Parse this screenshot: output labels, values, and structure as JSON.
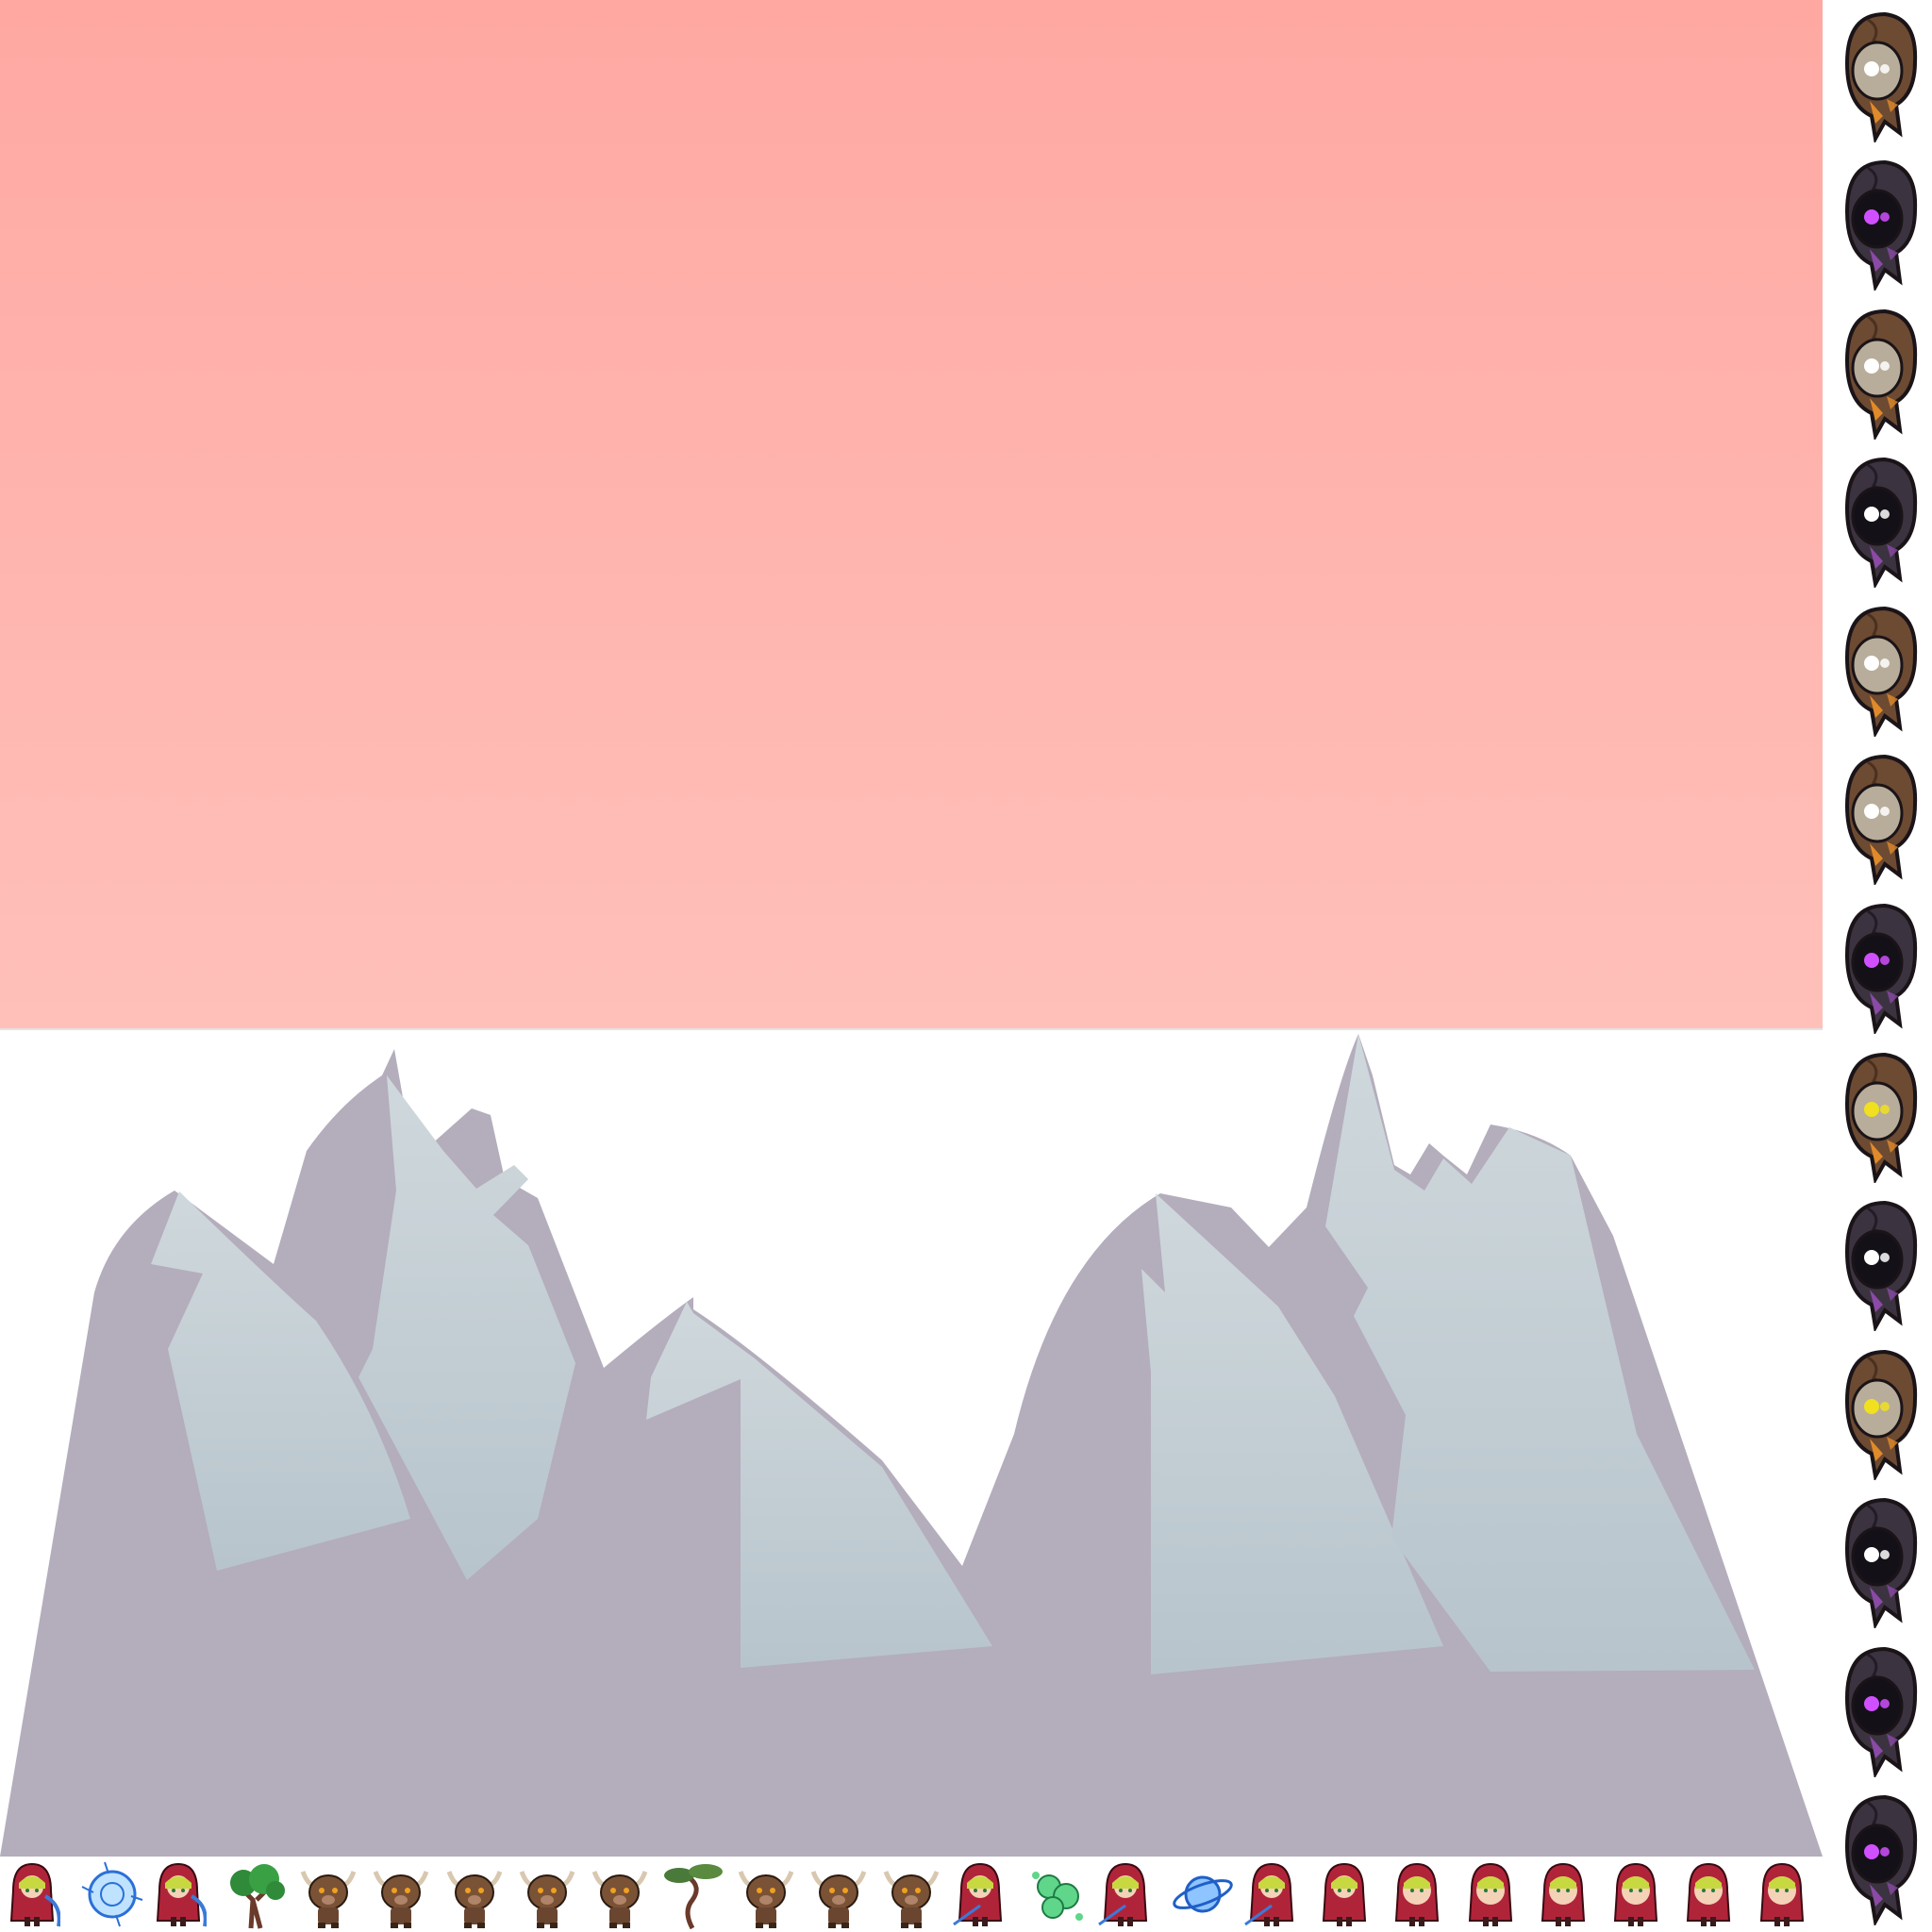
{
  "scene": {
    "sky": {
      "color_top": "#ffa8a2",
      "color_bottom": "#ffc0ba"
    },
    "mountains": {
      "shadow_color": "#b4adbc",
      "snow_top": "#cfd8dc",
      "snow_bottom": "#b7c4cc"
    }
  },
  "ghost_column": [
    {
      "kind": "brown-ghost",
      "eye": "#ffffff"
    },
    {
      "kind": "dark-ghost",
      "eye": "#d050ff"
    },
    {
      "kind": "brown-ghost",
      "eye": "#ffffff"
    },
    {
      "kind": "dark-ghost",
      "eye": "#ffffff"
    },
    {
      "kind": "brown-ghost",
      "eye": "#ffffff"
    },
    {
      "kind": "brown-ghost",
      "eye": "#ffffff"
    },
    {
      "kind": "dark-ghost",
      "eye": "#d050ff"
    },
    {
      "kind": "brown-ghost",
      "eye": "#f0e020"
    },
    {
      "kind": "dark-ghost",
      "eye": "#ffffff"
    },
    {
      "kind": "brown-ghost",
      "eye": "#f0e020"
    },
    {
      "kind": "dark-ghost",
      "eye": "#ffffff"
    },
    {
      "kind": "dark-ghost",
      "eye": "#d050ff"
    },
    {
      "kind": "dark-ghost",
      "eye": "#d050ff"
    }
  ],
  "sprite_row": [
    "red-hood-girl-slash",
    "blue-energy-orb",
    "red-hood-girl-slash",
    "oak-tree",
    "horned-minotaur",
    "horned-minotaur",
    "horned-minotaur",
    "horned-minotaur",
    "horned-minotaur",
    "twisted-tree",
    "horned-minotaur",
    "horned-minotaur",
    "horned-minotaur",
    "red-hood-girl-spear",
    "green-slime-cluster",
    "red-hood-girl-spear",
    "blue-ring-orb",
    "red-hood-girl-spear",
    "red-hood-girl",
    "red-hood-girl-face",
    "red-hood-girl-face",
    "red-hood-girl-face",
    "red-hood-girl-face",
    "red-hood-girl-face",
    "red-hood-girl-face"
  ]
}
